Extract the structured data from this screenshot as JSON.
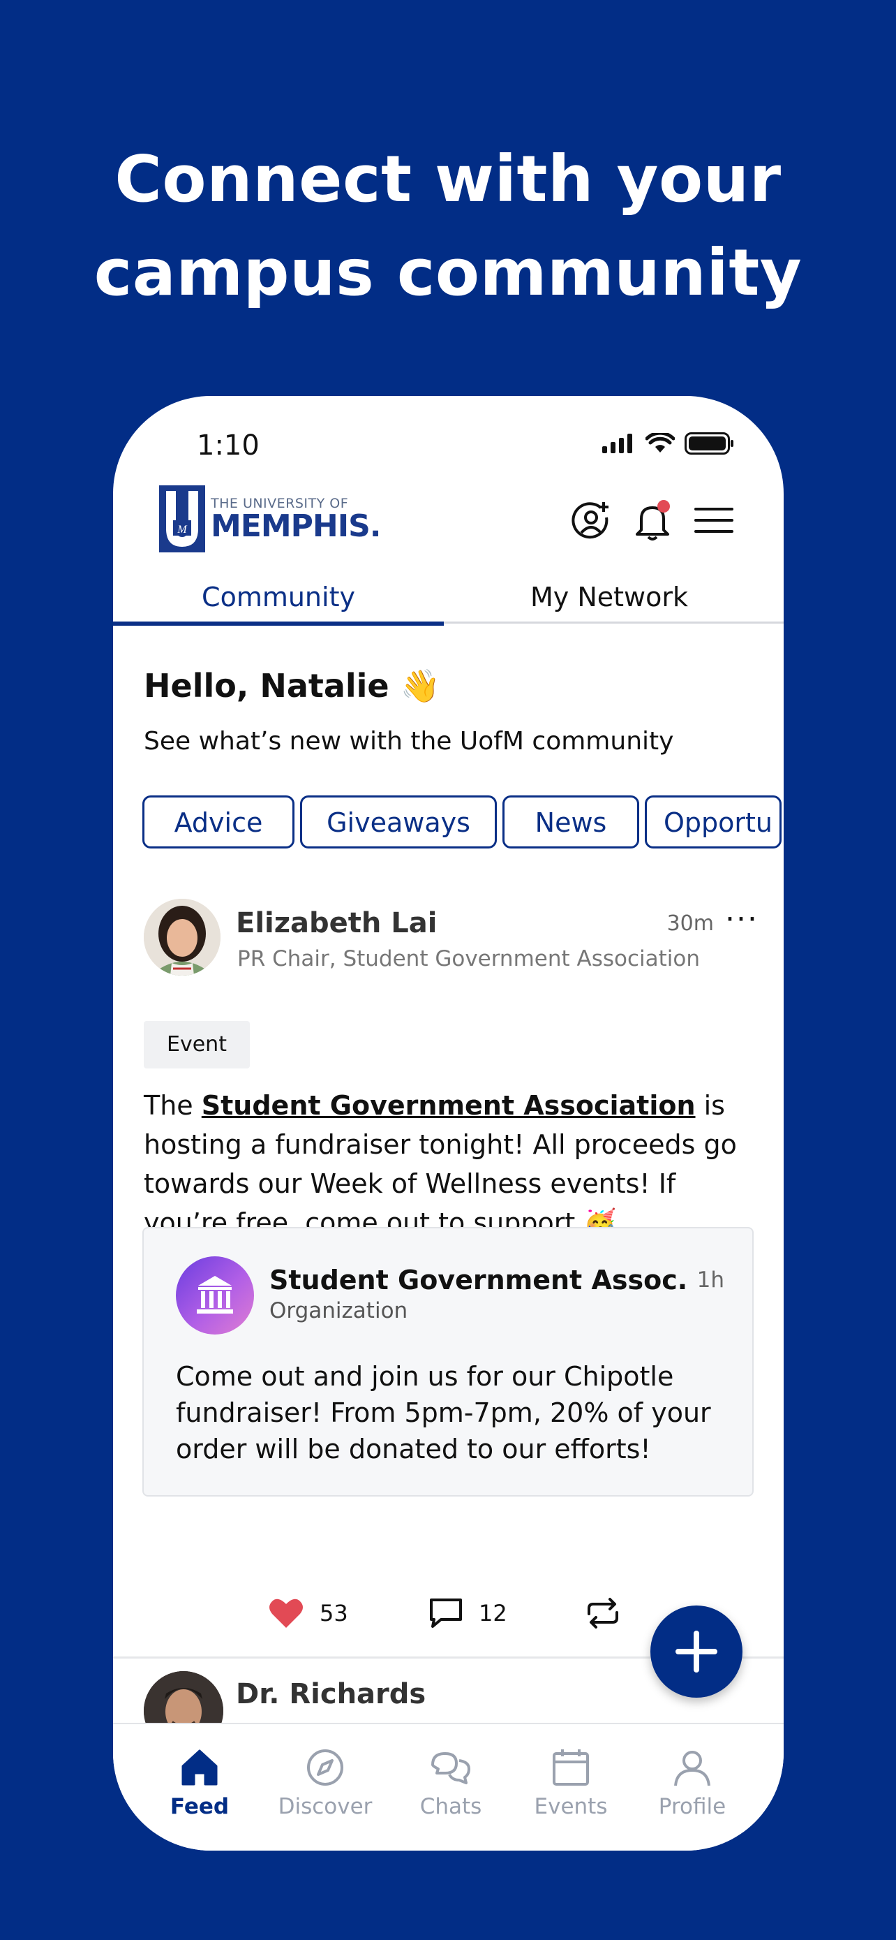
{
  "promo": {
    "headline_line1": "Connect with your",
    "headline_line2": "campus community"
  },
  "status_bar": {
    "time": "1:10"
  },
  "header": {
    "logo_small": "THE UNIVERSITY OF",
    "logo_big": "MEMPHIS.",
    "icons": [
      "add-user-icon",
      "bell-icon",
      "menu-icon"
    ],
    "notification_dot_color": "#e24a55"
  },
  "tabs": [
    {
      "label": "Community",
      "active": true
    },
    {
      "label": "My Network",
      "active": false
    }
  ],
  "greeting": {
    "title": "Hello, Natalie",
    "emoji": "👋",
    "subtitle": "See what’s new with the UofM community"
  },
  "filters": [
    "Advice",
    "Giveaways",
    "News",
    "Opportu"
  ],
  "post": {
    "author": "Elizabeth Lai",
    "role": "PR Chair, Student Government Association",
    "time": "30m",
    "more": "···",
    "tag": "Event",
    "text_prefix": "The ",
    "text_link": "Student Government Association",
    "text_suffix": " is hosting a fundraiser tonight! All proceeds go towards our Week of Wellness events! If you’re free, come out to support ",
    "text_emoji": "🥳",
    "shared": {
      "title": "Student Government Assoc.",
      "subtitle": "Organization",
      "time": "1h",
      "text": "Come out and join us for our Chipotle fundraiser! From 5pm-7pm, 20% of your order will be donated to our efforts!"
    },
    "likes": "53",
    "comments": "12"
  },
  "next_post": {
    "author": "Dr. Richards"
  },
  "bottom_nav": [
    {
      "label": "Feed",
      "icon": "home-icon",
      "active": true
    },
    {
      "label": "Discover",
      "icon": "compass-icon",
      "active": false
    },
    {
      "label": "Chats",
      "icon": "chat-icon",
      "active": false
    },
    {
      "label": "Events",
      "icon": "calendar-icon",
      "active": false
    },
    {
      "label": "Profile",
      "icon": "person-icon",
      "active": false
    }
  ],
  "colors": {
    "brand": "#022d86",
    "accent_blue": "#0a2f86",
    "like_red": "#e24a55"
  }
}
